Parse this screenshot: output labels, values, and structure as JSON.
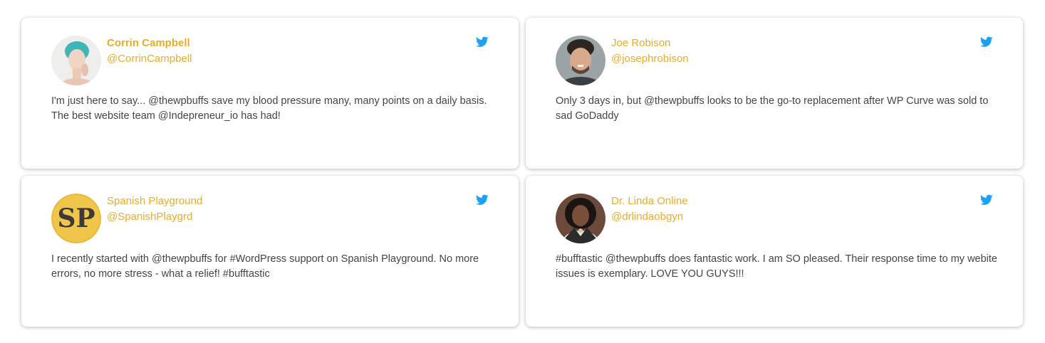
{
  "accent_color": "#e7ac2b",
  "twitter_color": "#1da1f2",
  "testimonials": [
    {
      "name": "Corrin Campbell",
      "handle": "@CorrinCampbell",
      "text": "I'm just here to say... @thewpbuffs save my blood pressure many, many points on a daily basis. The best website team @Indepreneur_io has had!",
      "icon": "twitter-bird-icon"
    },
    {
      "name": "Joe Robison",
      "handle": "@josephrobison",
      "text": "Only 3 days in, but @thewpbuffs looks to be the go-to replacement after WP Curve was sold to sad GoDaddy",
      "icon": "twitter-bird-icon"
    },
    {
      "name": "Spanish Playground",
      "handle": "@SpanishPlaygrd",
      "avatar_text": "SP",
      "text": "I recently started with @thewpbuffs for #WordPress support on Spanish Playground. No more errors, no more stress - what a relief! #bufftastic",
      "icon": "twitter-bird-icon"
    },
    {
      "name": "Dr. Linda Online",
      "handle": "@drlindaobgyn",
      "text": "#bufftastic @thewpbuffs does fantastic work. I am SO pleased. Their response time to my webite issues is exemplary. LOVE YOU GUYS!!!",
      "icon": "twitter-bird-icon"
    }
  ]
}
